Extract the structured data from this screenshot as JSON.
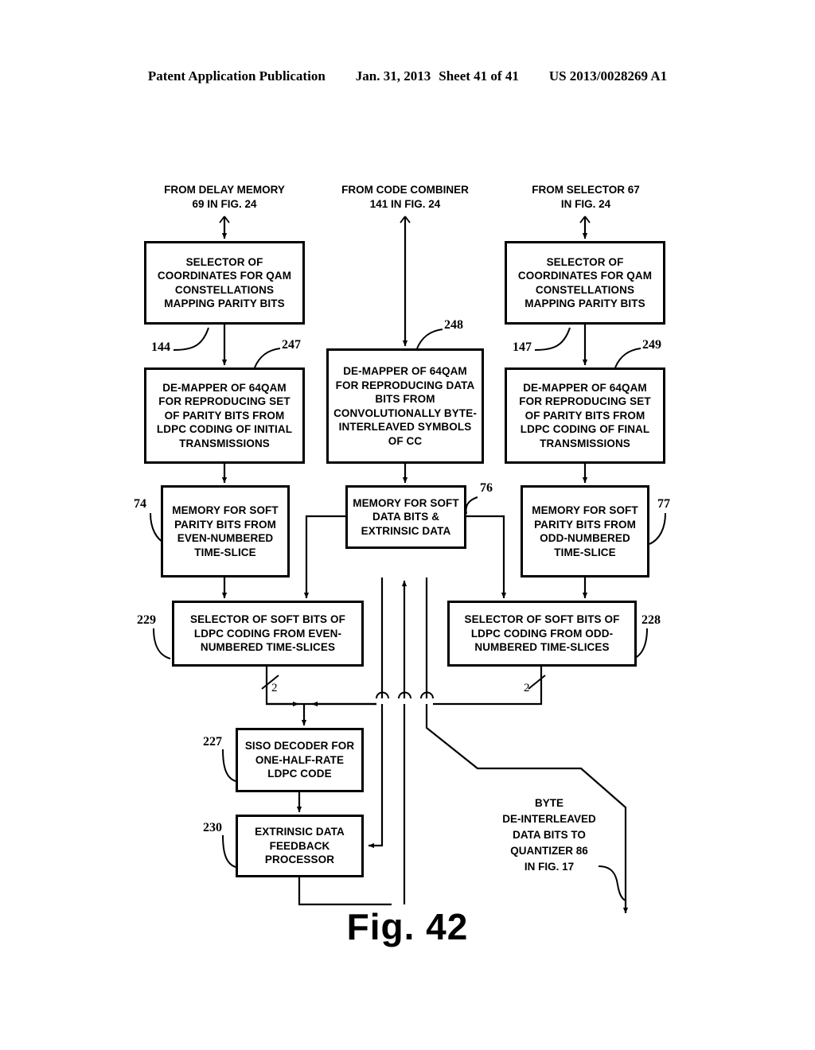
{
  "header": {
    "publication": "Patent Application Publication",
    "date": "Jan. 31, 2013",
    "sheet": "Sheet 41 of 41",
    "docnum": "US 2013/0028269 A1"
  },
  "figure": {
    "label": "Fig. 42"
  },
  "captions": {
    "source_left": "FROM DELAY MEMORY\n69 IN FIG. 24",
    "source_center": "FROM CODE COMBINER\n141 IN FIG. 24",
    "source_right": "FROM SELECTOR 67\nIN FIG. 24",
    "output": "BYTE\nDE-INTERLEAVED\nDATA BITS TO\nQUANTIZER 86\nIN FIG. 17"
  },
  "boxes": {
    "selector_left": "SELECTOR OF COORDINATES FOR QAM CONSTELLATIONS MAPPING PARITY BITS",
    "selector_right": "SELECTOR OF COORDINATES FOR QAM CONSTELLATIONS MAPPING PARITY BITS",
    "demapper_left": "DE-MAPPER OF 64QAM FOR REPRODUCING SET OF PARITY BITS FROM LDPC CODING OF INITIAL TRANSMISSIONS",
    "demapper_center": "DE-MAPPER OF 64QAM FOR REPRODUCING DATA BITS FROM CONVOLUTIONALLY BYTE-INTERLEAVED SYMBOLS OF CC",
    "demapper_right": "DE-MAPPER OF 64QAM FOR REPRODUCING SET OF PARITY BITS FROM LDPC CODING OF FINAL TRANSMISSIONS",
    "memory_left": "MEMORY FOR SOFT PARITY BITS FROM EVEN-NUMBERED TIME-SLICE",
    "memory_center": "MEMORY FOR SOFT DATA BITS & EXTRINSIC DATA",
    "memory_right": "MEMORY FOR SOFT PARITY BITS FROM ODD-NUMBERED TIME-SLICE",
    "bitselector_left": "SELECTOR OF SOFT BITS OF LDPC CODING FROM EVEN-NUMBERED TIME-SLICES",
    "bitselector_right": "SELECTOR OF SOFT BITS OF LDPC CODING FROM ODD-NUMBERED TIME-SLICES",
    "siso_decoder": "SISO DECODER FOR ONE-HALF-RATE LDPC CODE",
    "extrinsic_processor": "EXTRINSIC DATA FEEDBACK PROCESSOR"
  },
  "refnums": {
    "r144": "144",
    "r247": "247",
    "r248": "248",
    "r147": "147",
    "r249": "249",
    "r74": "74",
    "r76": "76",
    "r77": "77",
    "r229": "229",
    "r228": "228",
    "r227": "227",
    "r230": "230"
  },
  "busmarks": {
    "left": "2",
    "right": "2"
  }
}
